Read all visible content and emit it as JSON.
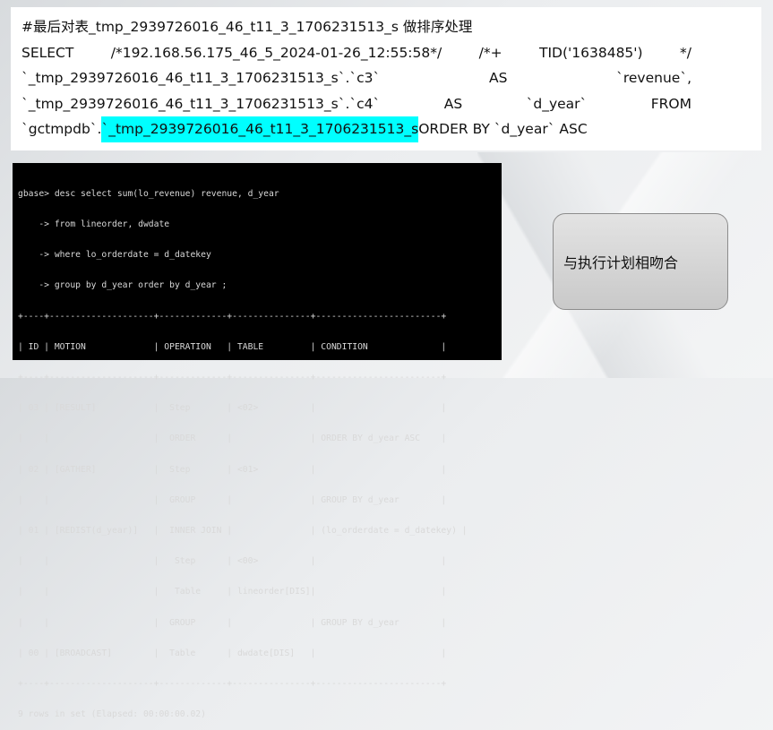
{
  "sql_box": {
    "comment": "#最后对表_tmp_2939726016_46_t11_3_1706231513_s 做排序处理",
    "line1": [
      "SELECT",
      "/*192.168.56.175_46_5_2024-01-26_12:55:58*/",
      "/*+",
      "TID('1638485')",
      "*/"
    ],
    "line2": [
      "`_tmp_2939726016_46_t11_3_1706231513_s`.`c3`",
      "AS",
      "`revenue`,"
    ],
    "line3": [
      "`_tmp_2939726016_46_t11_3_1706231513_s`.`c4`",
      "AS",
      "`d_year`",
      "FROM"
    ],
    "line4_prefix": "`gctmpdb`.",
    "line4_highlight": "`_tmp_2939726016_46_t11_3_1706231513_s",
    "line4_suffix": " ORDER BY `d_year` ASC",
    "highlight_color": "#00ffff"
  },
  "terminal": {
    "lines": [
      "gbase> desc select sum(lo_revenue) revenue, d_year",
      "    -> from lineorder, dwdate",
      "    -> where lo_orderdate = d_datekey",
      "    -> group by d_year order by d_year ;",
      "+----+--------------------+-------------+---------------+------------------------+",
      "| ID | MOTION             | OPERATION   | TABLE         | CONDITION              |",
      "+----+--------------------+-------------+---------------+------------------------+",
      "| 03 | [RESULT]           |  Step       | <02>          |                        |",
      "|    |                    |  ORDER      |               | ORDER BY d_year ASC    |",
      "| 02 | [GATHER]           |  Step       | <01>          |                        |",
      "|    |                    |  GROUP      |               | GROUP BY d_year        |",
      "| 01 | [REDIST(d_year)]   |  INNER JOIN |               | (lo_orderdate = d_datekey) |",
      "|    |                    |   Step      | <00>          |                        |",
      "|    |                    |   Table     | lineorder[DIS]|                        |",
      "|    |                    |  GROUP      |               | GROUP BY d_year        |",
      "| 00 | [BROADCAST]        |  Table      | dwdate[DIS]   |                        |",
      "+----+--------------------+-------------+---------------+------------------------+",
      "9 rows in set (Elapsed: 00:00:00.02)"
    ]
  },
  "callout": {
    "text": "与执行计划相吻合"
  }
}
